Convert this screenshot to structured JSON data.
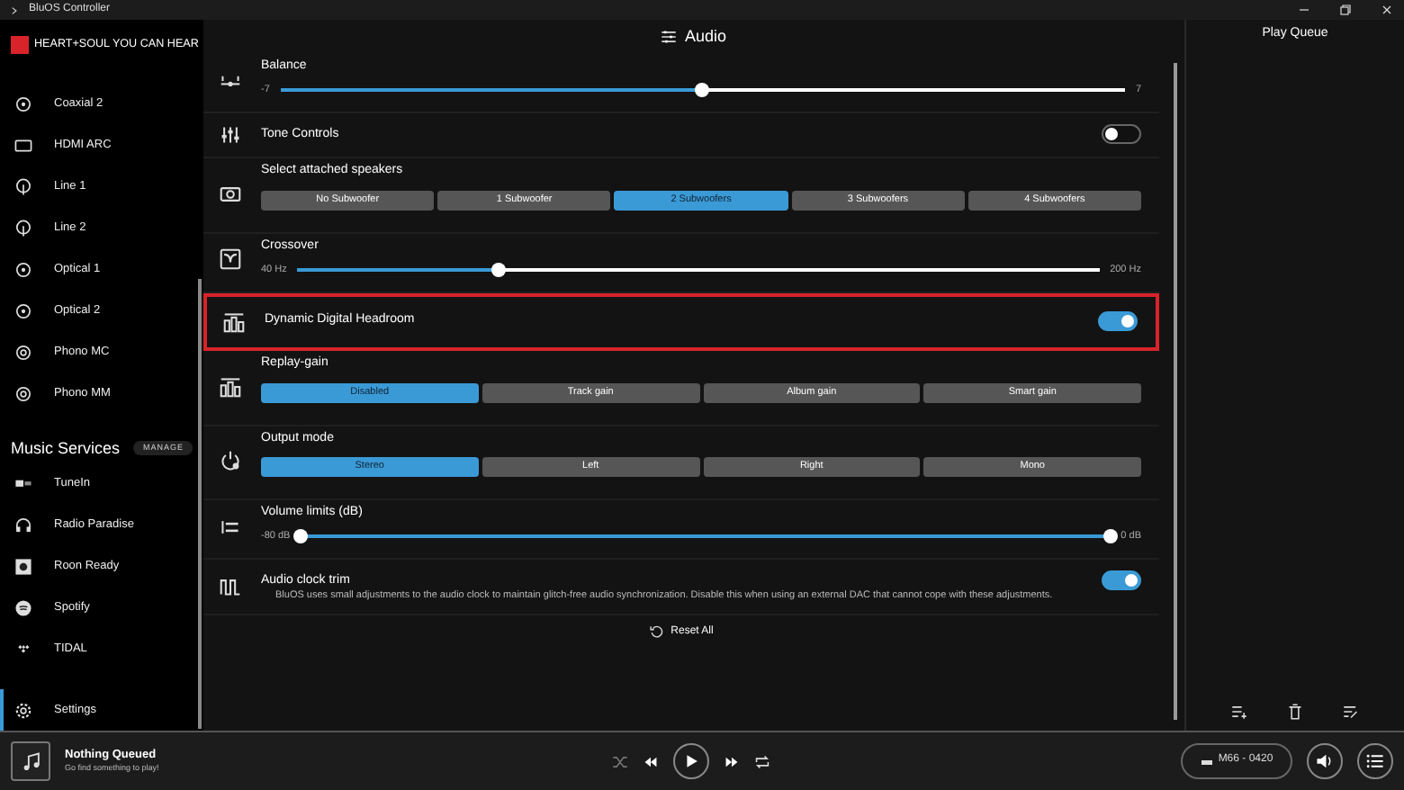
{
  "window": {
    "title": "BluOS Controller"
  },
  "sidebar": {
    "brand": "HEART+SOUL YOU CAN HEAR",
    "inputs": [
      {
        "label": "Coaxial 2",
        "selected": false
      },
      {
        "label": "HDMI ARC",
        "selected": false
      },
      {
        "label": "Line 1",
        "selected": false
      },
      {
        "label": "Line 2",
        "selected": false
      },
      {
        "label": "Optical 1",
        "selected": false
      },
      {
        "label": "Optical 2",
        "selected": false
      },
      {
        "label": "Phono MC",
        "selected": false
      },
      {
        "label": "Phono MM",
        "selected": false
      }
    ],
    "services_header": "Music Services",
    "manage": "MANAGE",
    "services": [
      {
        "label": "TuneIn",
        "selected": false
      },
      {
        "label": "Radio Paradise",
        "selected": false
      },
      {
        "label": "Roon Ready",
        "selected": false
      },
      {
        "label": "Spotify",
        "selected": false
      },
      {
        "label": "TIDAL",
        "selected": false
      }
    ],
    "settings": {
      "label": "Settings",
      "selected": true
    }
  },
  "main": {
    "title": "Audio",
    "rows": [
      {
        "kind": "slider",
        "label": "Balance",
        "min_label": "-7",
        "max_label": "7",
        "level": 0.5,
        "highlighted": false
      },
      {
        "kind": "toggle",
        "label": "Tone Controls",
        "on": false,
        "highlighted": false
      },
      {
        "kind": "segments",
        "label": "Select attached speakers",
        "highlighted": false,
        "options": [
          {
            "label": "No Subwoofer",
            "selected": false
          },
          {
            "label": "1 Subwoofer",
            "selected": false
          },
          {
            "label": "2 Subwoofers",
            "selected": true
          },
          {
            "label": "3 Subwoofers",
            "selected": false
          },
          {
            "label": "4 Subwoofers",
            "selected": false
          }
        ]
      },
      {
        "kind": "slider",
        "label": "Crossover",
        "min_label": "40 Hz",
        "max_label": "200 Hz",
        "level": 0.25,
        "highlighted": false
      },
      {
        "kind": "toggle",
        "label": "Dynamic Digital Headroom",
        "on": true,
        "highlighted": true
      },
      {
        "kind": "segments",
        "label": "Replay-gain",
        "highlighted": false,
        "options": [
          {
            "label": "Disabled",
            "selected": true
          },
          {
            "label": "Track gain",
            "selected": false
          },
          {
            "label": "Album gain",
            "selected": false
          },
          {
            "label": "Smart gain",
            "selected": false
          }
        ]
      },
      {
        "kind": "segments",
        "label": "Output mode",
        "highlighted": false,
        "options": [
          {
            "label": "Stereo",
            "selected": true
          },
          {
            "label": "Left",
            "selected": false
          },
          {
            "label": "Right",
            "selected": false
          },
          {
            "label": "Mono",
            "selected": false
          }
        ]
      },
      {
        "kind": "range",
        "label": "Volume limits (dB)",
        "min_label": "-80 dB",
        "max_label": "0 dB",
        "highlighted": false,
        "thumbs": [
          {
            "level": 0
          },
          {
            "level": 1
          }
        ]
      },
      {
        "kind": "toggle",
        "label": "Audio clock trim",
        "description": "BluOS uses small adjustments to the audio clock to maintain glitch-free audio synchronization. Disable this when using an external DAC that cannot cope with these adjustments.",
        "on": true,
        "highlighted": false
      }
    ],
    "reset": "Reset All"
  },
  "queue": {
    "title": "Play Queue"
  },
  "player": {
    "title": "Nothing Queued",
    "subtitle": "Go find something to play!",
    "device": "M66 - 0420"
  }
}
